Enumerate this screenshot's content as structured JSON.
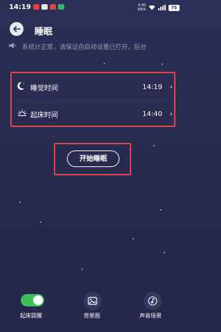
{
  "status_bar": {
    "time": "14:19",
    "net_speed": "0.00",
    "net_unit": "KB/S",
    "battery": "75"
  },
  "header": {
    "back_icon": "arrow-left-icon",
    "title": "睡眠"
  },
  "notice": {
    "icon": "megaphone-icon",
    "text": "系统计正常，请保证自启动设置已打开，后台"
  },
  "settings": {
    "rows": [
      {
        "icon": "moon-icon",
        "label": "睡觉时间",
        "value": "14:19"
      },
      {
        "icon": "sunrise-icon",
        "label": "起床时间",
        "value": "14:40"
      }
    ]
  },
  "start_button": {
    "label": "开始睡眠"
  },
  "bottom_bar": {
    "alarm": {
      "label": "起床提醒",
      "enabled": true
    },
    "background": {
      "icon": "image-icon",
      "label": "背景图"
    },
    "sound": {
      "icon": "music-note-icon",
      "label": "声音场景"
    }
  },
  "colors": {
    "background": "#2a2c52",
    "highlight": "#e0484a",
    "toggle_on": "#3fbf5a"
  }
}
